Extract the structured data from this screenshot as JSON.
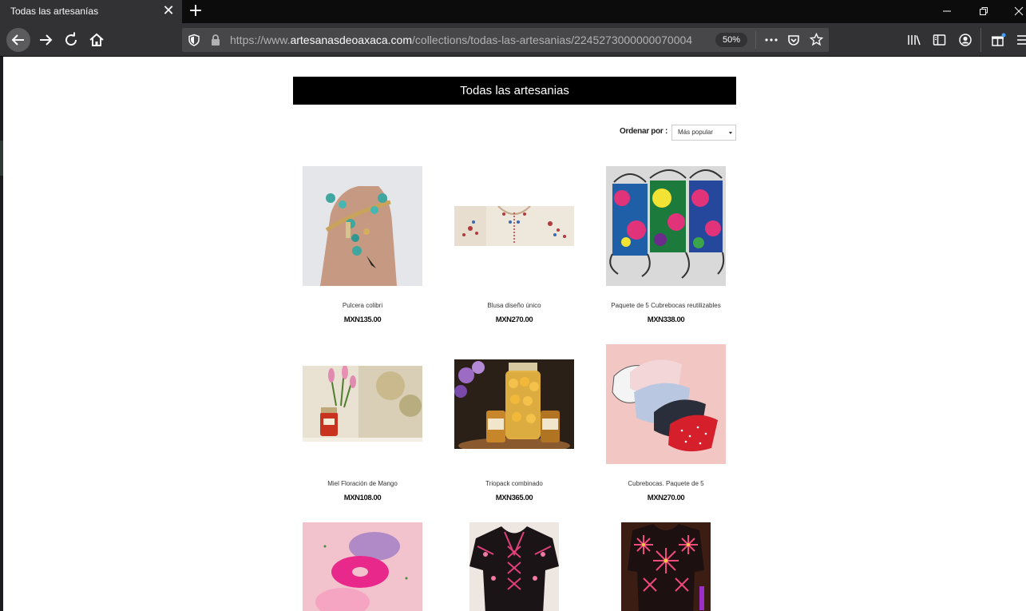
{
  "browser": {
    "tab_title": "Todas las artesanías",
    "tab_close_glyph": "✕",
    "new_tab_glyph": "+",
    "url_prefix": "https://www.",
    "url_domain": "artesanasdeoaxaca.com",
    "url_path": "/collections/todas-las-artesanias/2245273000000070004",
    "zoom": "50%",
    "icons": [
      "back-arrow-icon",
      "forward-arrow-icon",
      "reload-icon",
      "home-icon",
      "shield-icon",
      "lock-icon",
      "more-dots-icon",
      "pocket-icon",
      "bookmark-star-icon",
      "library-icon",
      "sidebar-icon",
      "account-icon",
      "extensions-icon",
      "menu-icon",
      "minimize-icon",
      "restore-icon",
      "close-window-icon"
    ]
  },
  "page": {
    "heading": "Todas las artesanias",
    "sort_label": "Ordenar por :",
    "sort_value": "Más popular",
    "products": [
      {
        "name": "Pulcera colibri",
        "price": "MXN135.00"
      },
      {
        "name": "Blusa diseño único",
        "price": "MXN270.00"
      },
      {
        "name": "Paquete de 5 Cubrebocas reutilizables",
        "price": "MXN338.00"
      },
      {
        "name": "Miel Floración de Mango",
        "price": "MXN108.00"
      },
      {
        "name": "Triopack combinado",
        "price": "MXN365.00"
      },
      {
        "name": "Cubrebocas. Paquete de 5",
        "price": "MXN270.00"
      },
      {
        "name": "",
        "price": ""
      },
      {
        "name": "",
        "price": ""
      },
      {
        "name": "",
        "price": ""
      }
    ]
  },
  "colors": {
    "tabbar": "#0c0c0d",
    "toolbar": "#323234",
    "urlbar": "#474749",
    "banner": "#000000"
  }
}
